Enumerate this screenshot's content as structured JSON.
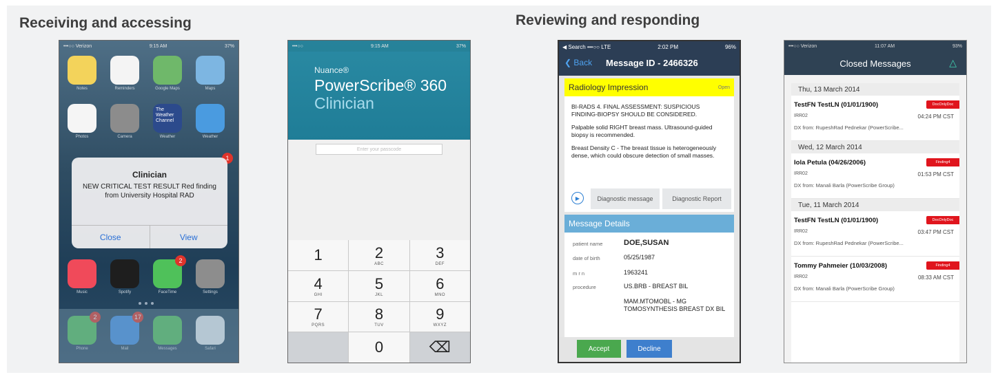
{
  "sections": {
    "left_title": "Receiving and accessing",
    "right_title": "Reviewing and responding"
  },
  "phone1": {
    "status": {
      "carrier": "•••○○ Verizon",
      "time": "9:15 AM",
      "battery": "37%"
    },
    "apps": [
      {
        "label": "Notes",
        "icon": "notes-icon",
        "color": "#f3d35b"
      },
      {
        "label": "Reminders",
        "icon": "reminders-icon",
        "color": "#f4f4f4"
      },
      {
        "label": "Google Maps",
        "icon": "maps-icon",
        "color": "#6fb86a"
      },
      {
        "label": "Maps",
        "icon": "apple-maps-icon",
        "color": "#7db6e2"
      },
      {
        "label": "Photos",
        "icon": "photos-icon",
        "color": "#f5f5f5"
      },
      {
        "label": "Camera",
        "icon": "camera-icon",
        "color": "#8c8c8c"
      },
      {
        "label": "Weather",
        "icon": "weather-channel-icon",
        "color": "#2c4a8c",
        "text": "The Weather Channel"
      },
      {
        "label": "Weather",
        "icon": "weather-icon",
        "color": "#4a9be0"
      }
    ],
    "dock_apps": [
      {
        "label": "Phone",
        "icon": "phone-icon",
        "color": "#4fc15a",
        "badge": "2"
      },
      {
        "label": "Mail",
        "icon": "mail-icon",
        "color": "#3f8ee8",
        "badge": "17"
      },
      {
        "label": "Messages",
        "icon": "messages-icon",
        "color": "#4fc15a"
      },
      {
        "label": "Safari",
        "icon": "safari-icon",
        "color": "#e8eef5"
      }
    ],
    "row4_apps": [
      {
        "label": "Music",
        "icon": "music-icon",
        "color": "#f04a5a"
      },
      {
        "label": "Spotify",
        "icon": "spotify-icon",
        "color": "#1e1e1e"
      },
      {
        "label": "FaceTime",
        "icon": "facetime-icon",
        "color": "#4fc15a",
        "badge": "2"
      },
      {
        "label": "Settings",
        "icon": "settings-icon",
        "color": "#8d8d8d"
      }
    ],
    "alert": {
      "title": "Clinician",
      "message": "NEW CRITICAL TEST RESULT Red finding from University Hospital RAD",
      "close": "Close",
      "view": "View"
    },
    "alert_badge": "1"
  },
  "phone2": {
    "brand_top": "Nuance®",
    "brand_name": "PowerScribe® 360",
    "brand_sub": "Clinician",
    "password_placeholder": "Enter your passcode",
    "keys": [
      {
        "n": "1",
        "l": ""
      },
      {
        "n": "2",
        "l": "ABC"
      },
      {
        "n": "3",
        "l": "DEF"
      },
      {
        "n": "4",
        "l": "GHI"
      },
      {
        "n": "5",
        "l": "JKL"
      },
      {
        "n": "6",
        "l": "MNO"
      },
      {
        "n": "7",
        "l": "PQRS"
      },
      {
        "n": "8",
        "l": "TUV"
      },
      {
        "n": "9",
        "l": "WXYZ"
      },
      {
        "n": "",
        "l": ""
      },
      {
        "n": "0",
        "l": ""
      },
      {
        "n": "⌫",
        "l": ""
      }
    ]
  },
  "phone3": {
    "status": {
      "left": "◀ Search •••○○ LTE",
      "time": "2:02 PM",
      "battery": "96%"
    },
    "back": "❮ Back",
    "title": "Message ID - 2466326",
    "impression": {
      "header": "Radiology Impression",
      "state": "Open",
      "p1": "BI-RADS 4. FINAL ASSESSMENT: SUSPICIOUS FINDING-BIOPSY SHOULD BE CONSIDERED.",
      "p2": "Palpable solid RIGHT breast mass. Ultrasound-guided biopsy is recommended.",
      "p3": "Breast Density C - The breast tissue is heterogeneously dense, which could obscure detection of small masses."
    },
    "diag_message": "Diagnostic message",
    "diag_report": "Diagnostic Report",
    "details_header": "Message Details",
    "details": {
      "patient_name_label": "patient name",
      "patient_name": "DOE,SUSAN",
      "dob_label": "date of birth",
      "dob": "05/25/1987",
      "mrn_label": "m r n",
      "mrn": "1963241",
      "procedure_label": "procedure",
      "procedure1": "US.BRB - BREAST BIL",
      "procedure2": "MAM.MTOMOBL - MG TOMOSYNTHESIS BREAST DX BIL"
    },
    "accept": "Accept",
    "decline": "Decline"
  },
  "phone4": {
    "status": {
      "carrier": "•••○○ Verizon",
      "time": "11:07 AM",
      "battery": "93%"
    },
    "title": "Closed Messages",
    "groups": [
      {
        "date": "Thu, 13 March 2014",
        "items": [
          {
            "name": "TestFN TestLN (01/01/1900)",
            "tag": "DocOnlyDoc",
            "code": "IRR02",
            "time": "04:24 PM CST",
            "from": "DX from: RupeshRad Pednekar (PowerScribe..."
          }
        ]
      },
      {
        "date": "Wed, 12 March 2014",
        "items": [
          {
            "name": "Iola Petula (04/26/2006)",
            "tag": "Finding4",
            "code": "IRR02",
            "time": "01:53 PM CST",
            "from": "DX from: Manali Barla (PowerScribe Group)"
          }
        ]
      },
      {
        "date": "Tue, 11 March 2014",
        "items": [
          {
            "name": "TestFN TestLN (01/01/1900)",
            "tag": "DocOnlyDoc",
            "code": "IRR02",
            "time": "03:47 PM CST",
            "from": "DX from: RupeshRad Pednekar (PowerScribe..."
          },
          {
            "name": "Tommy Pahmeier (10/03/2008)",
            "tag": "Finding4",
            "code": "IRR02",
            "time": "08:33 AM CST",
            "from": "DX from: Manali Barla (PowerScribe Group)"
          }
        ]
      }
    ]
  }
}
